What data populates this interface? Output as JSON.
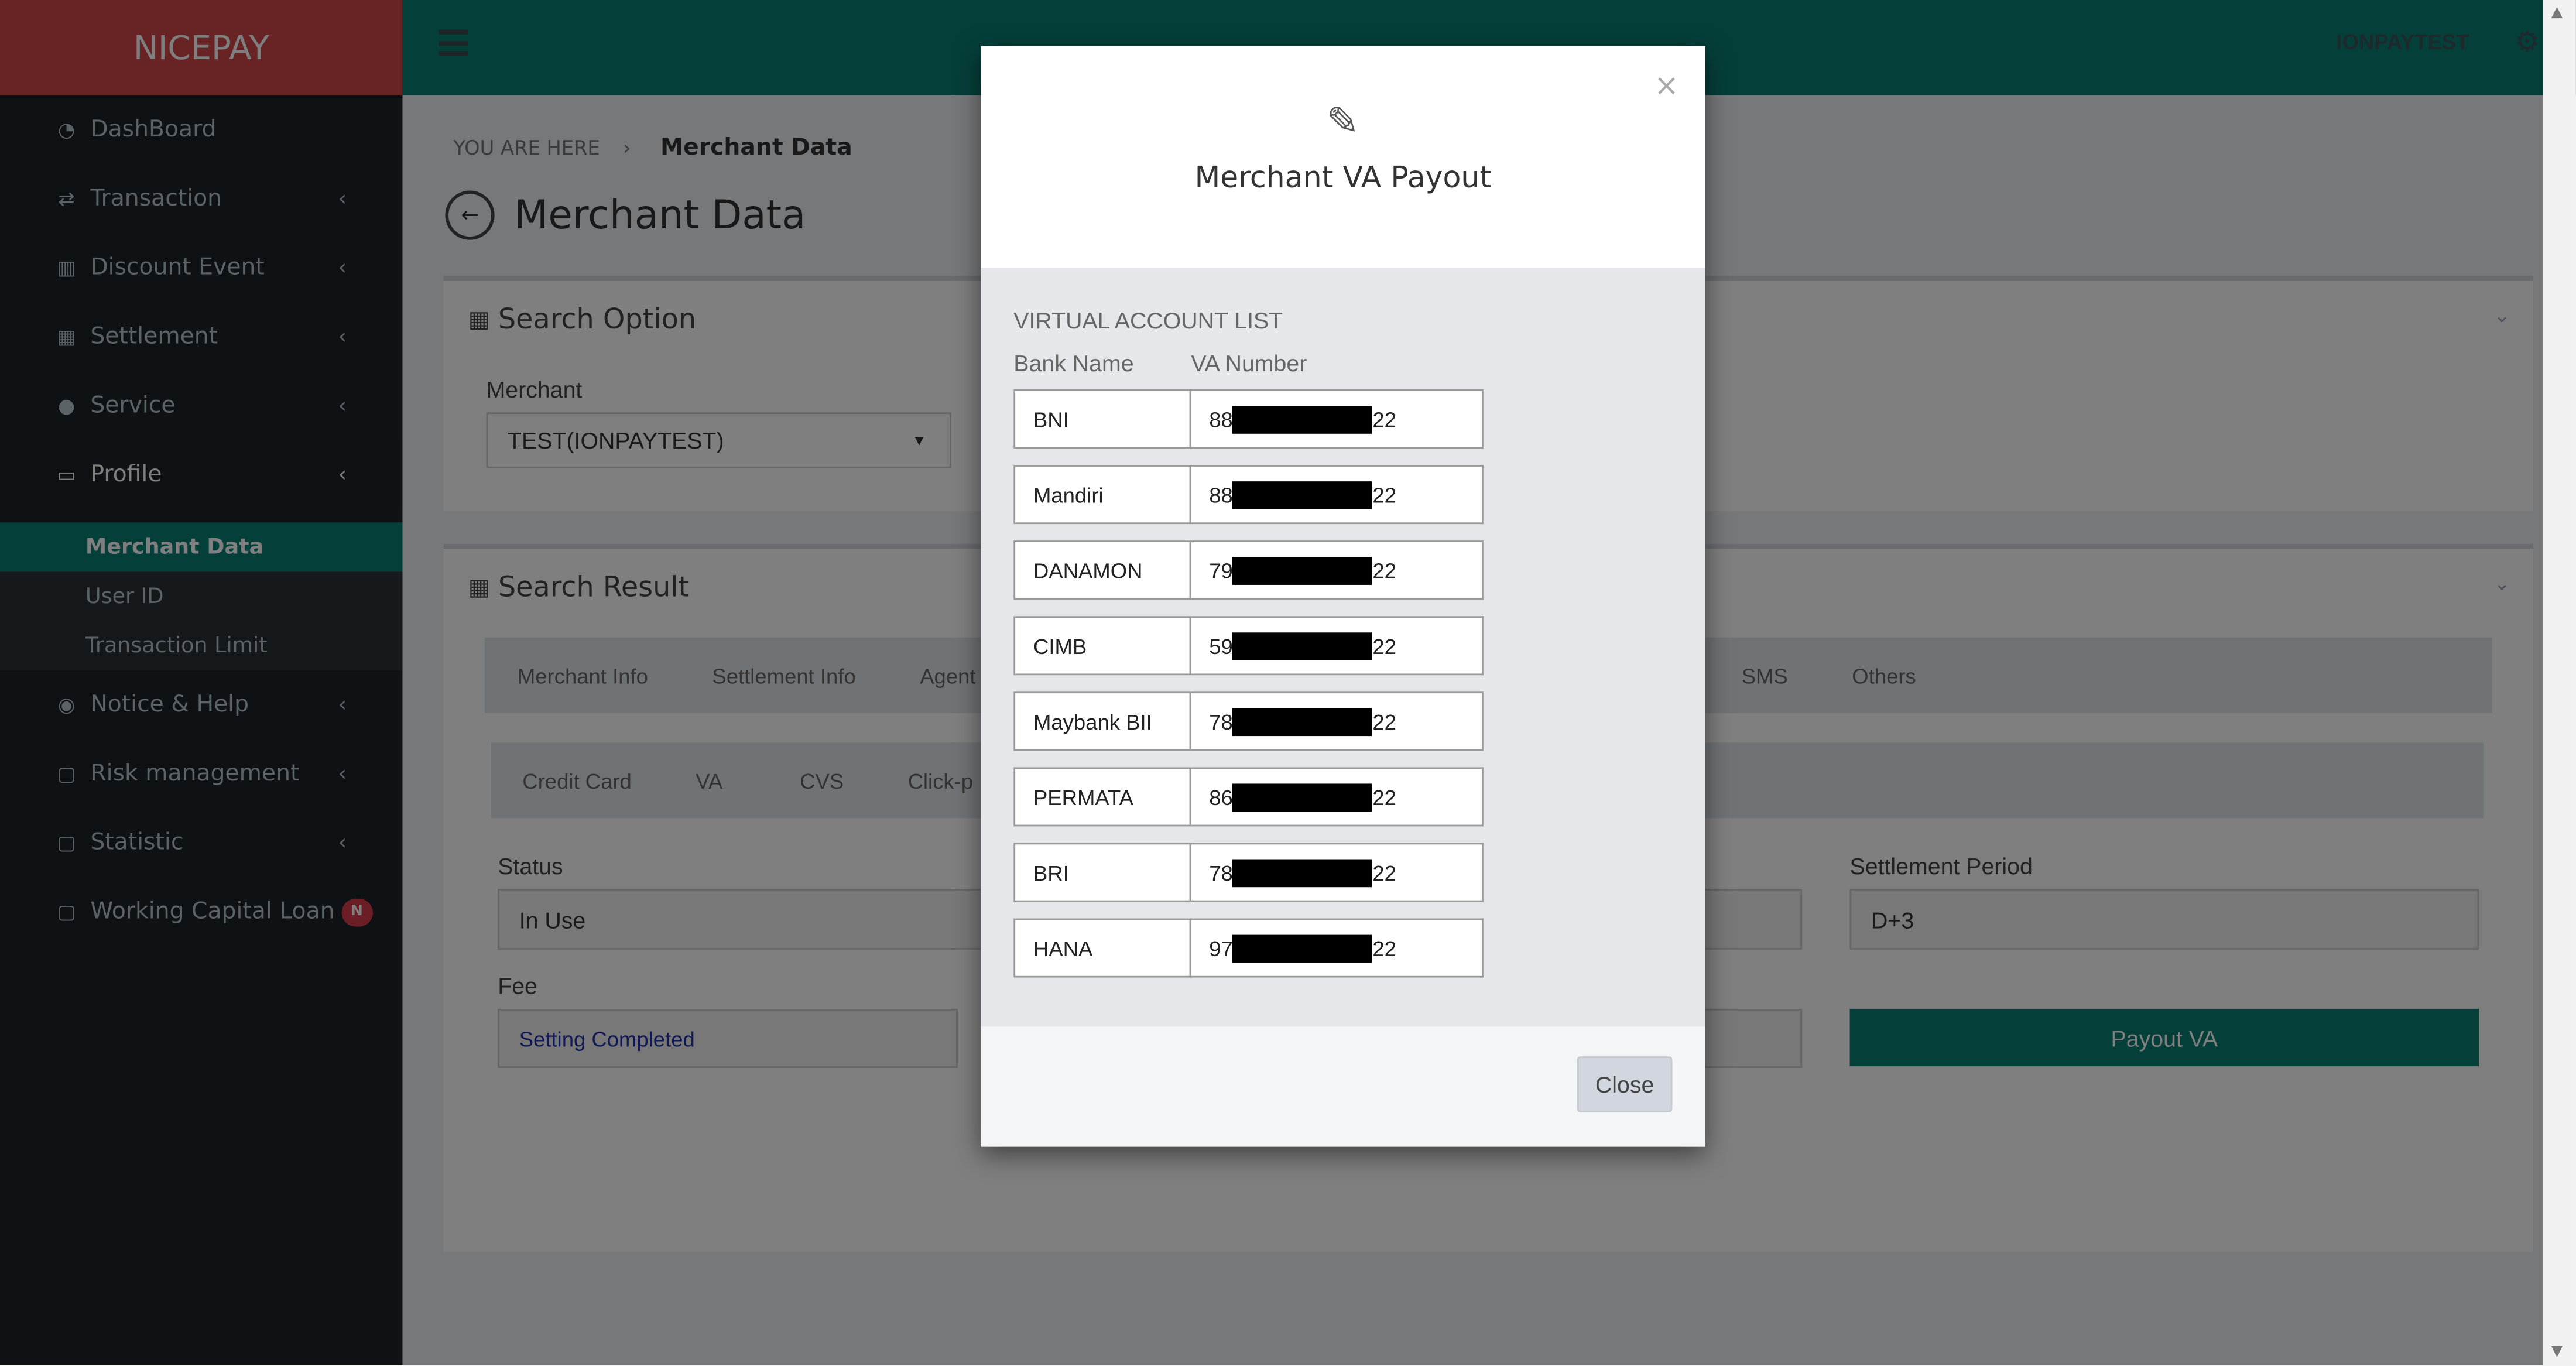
{
  "app": {
    "brand": "NICEPAY",
    "user": "IONPAYTEST"
  },
  "sidebar": {
    "items": [
      {
        "label": "DashBoard",
        "icon": "dashboard-icon"
      },
      {
        "label": "Transaction",
        "icon": "exchange-icon"
      },
      {
        "label": "Discount Event",
        "icon": "bar-chart-icon"
      },
      {
        "label": "Settlement",
        "icon": "calendar-icon"
      },
      {
        "label": "Service",
        "icon": "users-icon"
      },
      {
        "label": "Profile",
        "icon": "monitor-icon"
      },
      {
        "label": "Notice & Help",
        "icon": "comment-icon"
      },
      {
        "label": "Risk management",
        "icon": "folder-icon"
      },
      {
        "label": "Statistic",
        "icon": "folder-icon"
      },
      {
        "label": "Working Capital Loan",
        "icon": "folder-icon",
        "badge": "N"
      }
    ],
    "profile_sub": [
      "Merchant Data",
      "User ID",
      "Transaction Limit"
    ]
  },
  "breadcrumb": {
    "prefix": "YOU ARE HERE",
    "current": "Merchant Data"
  },
  "page_title": "Merchant Data",
  "search_option": {
    "title": "Search Option",
    "merchant_label": "Merchant",
    "merchant_value": "TEST(IONPAYTEST)"
  },
  "search_result": {
    "title": "Search Result",
    "tabs": [
      "Merchant Info",
      "Settlement Info",
      "Agent I",
      "SMS",
      "Others"
    ],
    "subtabs": [
      "Credit Card",
      "VA",
      "CVS",
      "Click-p"
    ],
    "status_label": "Status",
    "status_value": "In Use",
    "fee_label": "Fee",
    "fee_value": "Setting Completed",
    "settlement_period_label": "Settlement Period",
    "settlement_period_value": "D+3",
    "payout_button": "Payout VA"
  },
  "modal": {
    "title": "Merchant VA Payout",
    "list_title": "VIRTUAL ACCOUNT LIST",
    "col_bank": "Bank Name",
    "col_va": "VA Number",
    "rows": [
      {
        "bank": "BNI",
        "prefix": "88",
        "suffix": "22"
      },
      {
        "bank": "Mandiri",
        "prefix": "88",
        "suffix": "22"
      },
      {
        "bank": "DANAMON",
        "prefix": "79",
        "suffix": "22"
      },
      {
        "bank": "CIMB",
        "prefix": "59",
        "suffix": "22"
      },
      {
        "bank": "Maybank BII",
        "prefix": "78",
        "suffix": "22"
      },
      {
        "bank": "PERMATA",
        "prefix": "86",
        "suffix": "22"
      },
      {
        "bank": "BRI",
        "prefix": "78",
        "suffix": "22"
      },
      {
        "bank": "HANA",
        "prefix": "97",
        "suffix": "22"
      }
    ],
    "close_label": "Close"
  },
  "colors": {
    "brand": "#d0484a",
    "accent": "#0a7f74",
    "sidebar": "#1f2428"
  }
}
